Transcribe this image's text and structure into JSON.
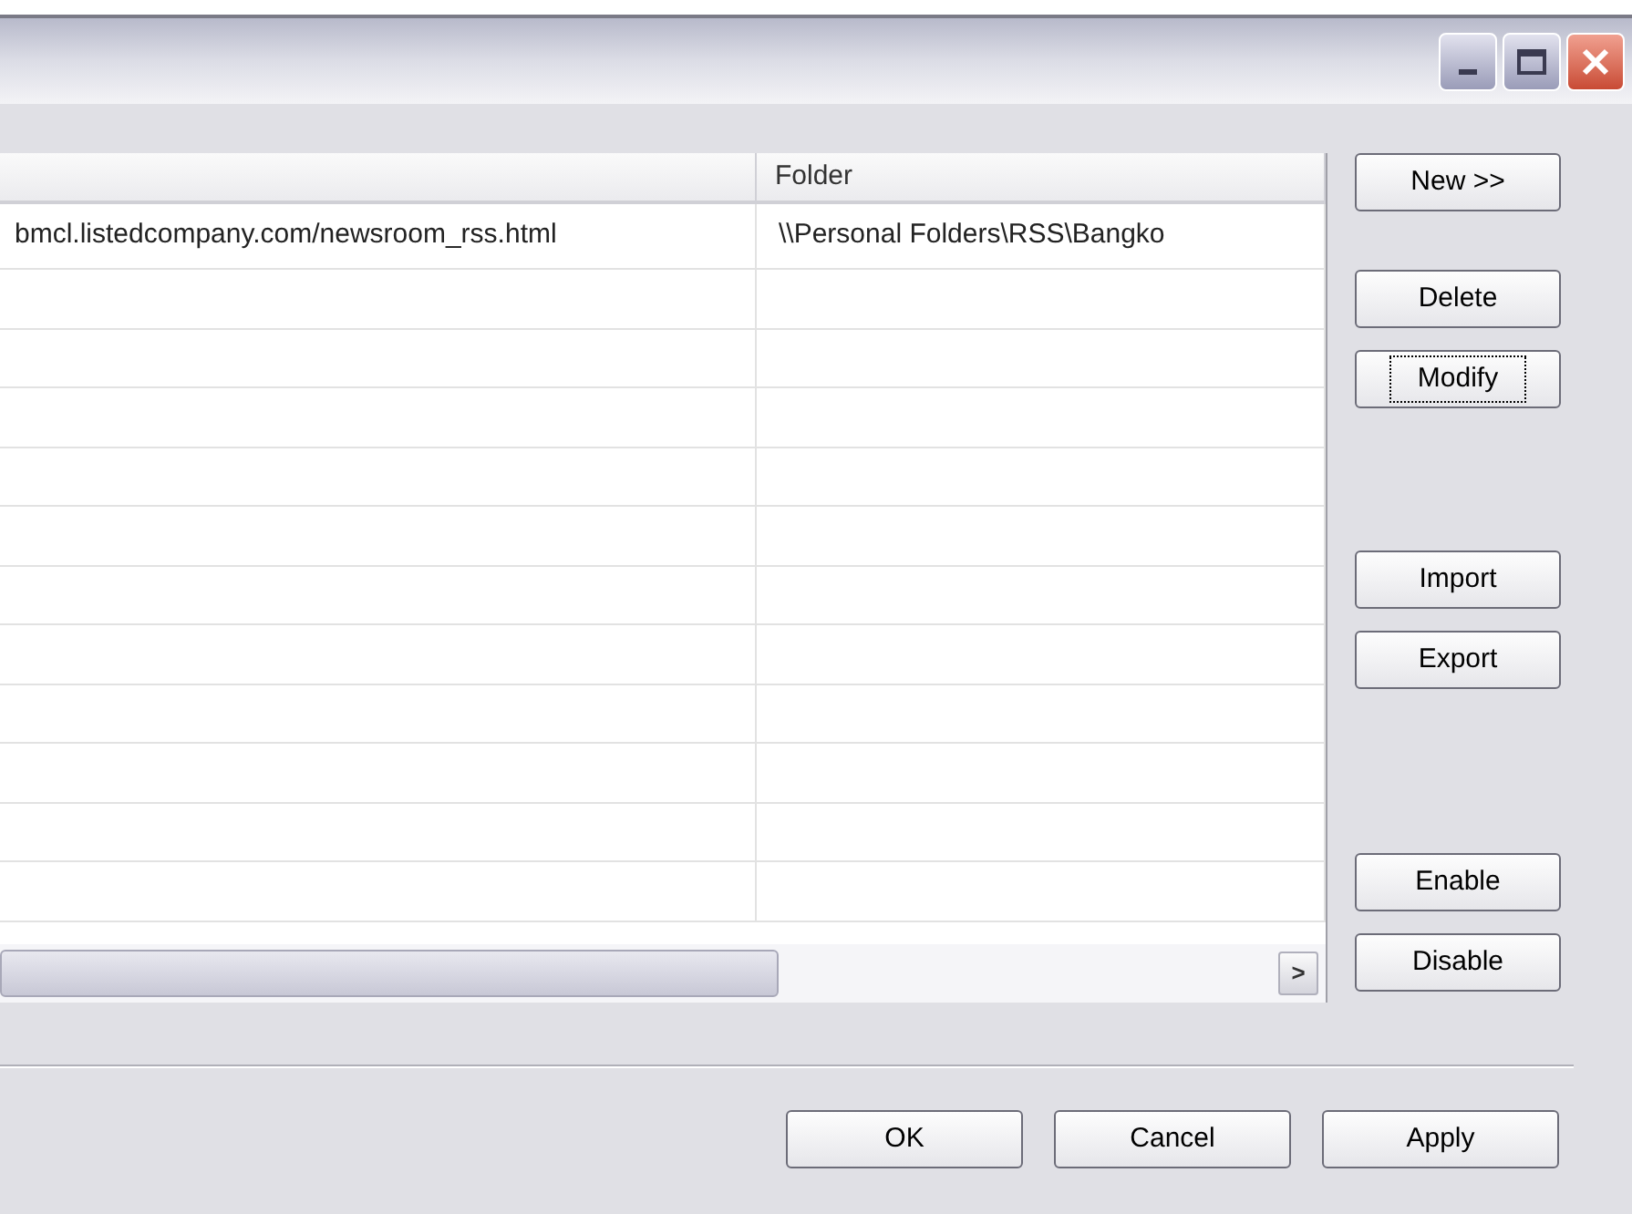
{
  "table": {
    "columns": [
      {},
      {
        "label": "Folder"
      }
    ],
    "rows": [
      [
        "bmcl.listedcompany.com/newsroom_rss.html",
        "\\\\Personal Folders\\RSS\\Bangko"
      ],
      [
        "",
        ""
      ],
      [
        "",
        ""
      ],
      [
        "",
        ""
      ],
      [
        "",
        ""
      ],
      [
        "",
        ""
      ],
      [
        "",
        ""
      ],
      [
        "",
        ""
      ],
      [
        "",
        ""
      ],
      [
        "",
        ""
      ],
      [
        "",
        ""
      ],
      [
        "",
        ""
      ]
    ]
  },
  "side_buttons": [
    {
      "label": "New >>",
      "focused": false
    },
    {
      "label": "Delete",
      "focused": false
    },
    {
      "label": "Modify",
      "focused": true
    },
    {
      "label": "Import",
      "focused": false
    },
    {
      "label": "Export",
      "focused": false
    },
    {
      "label": "Enable",
      "focused": false
    },
    {
      "label": "Disable",
      "focused": false
    }
  ],
  "scrollbar_arrow": ">",
  "footer_buttons": [
    {
      "label": "OK"
    },
    {
      "label": "Cancel"
    },
    {
      "label": "Apply"
    }
  ]
}
